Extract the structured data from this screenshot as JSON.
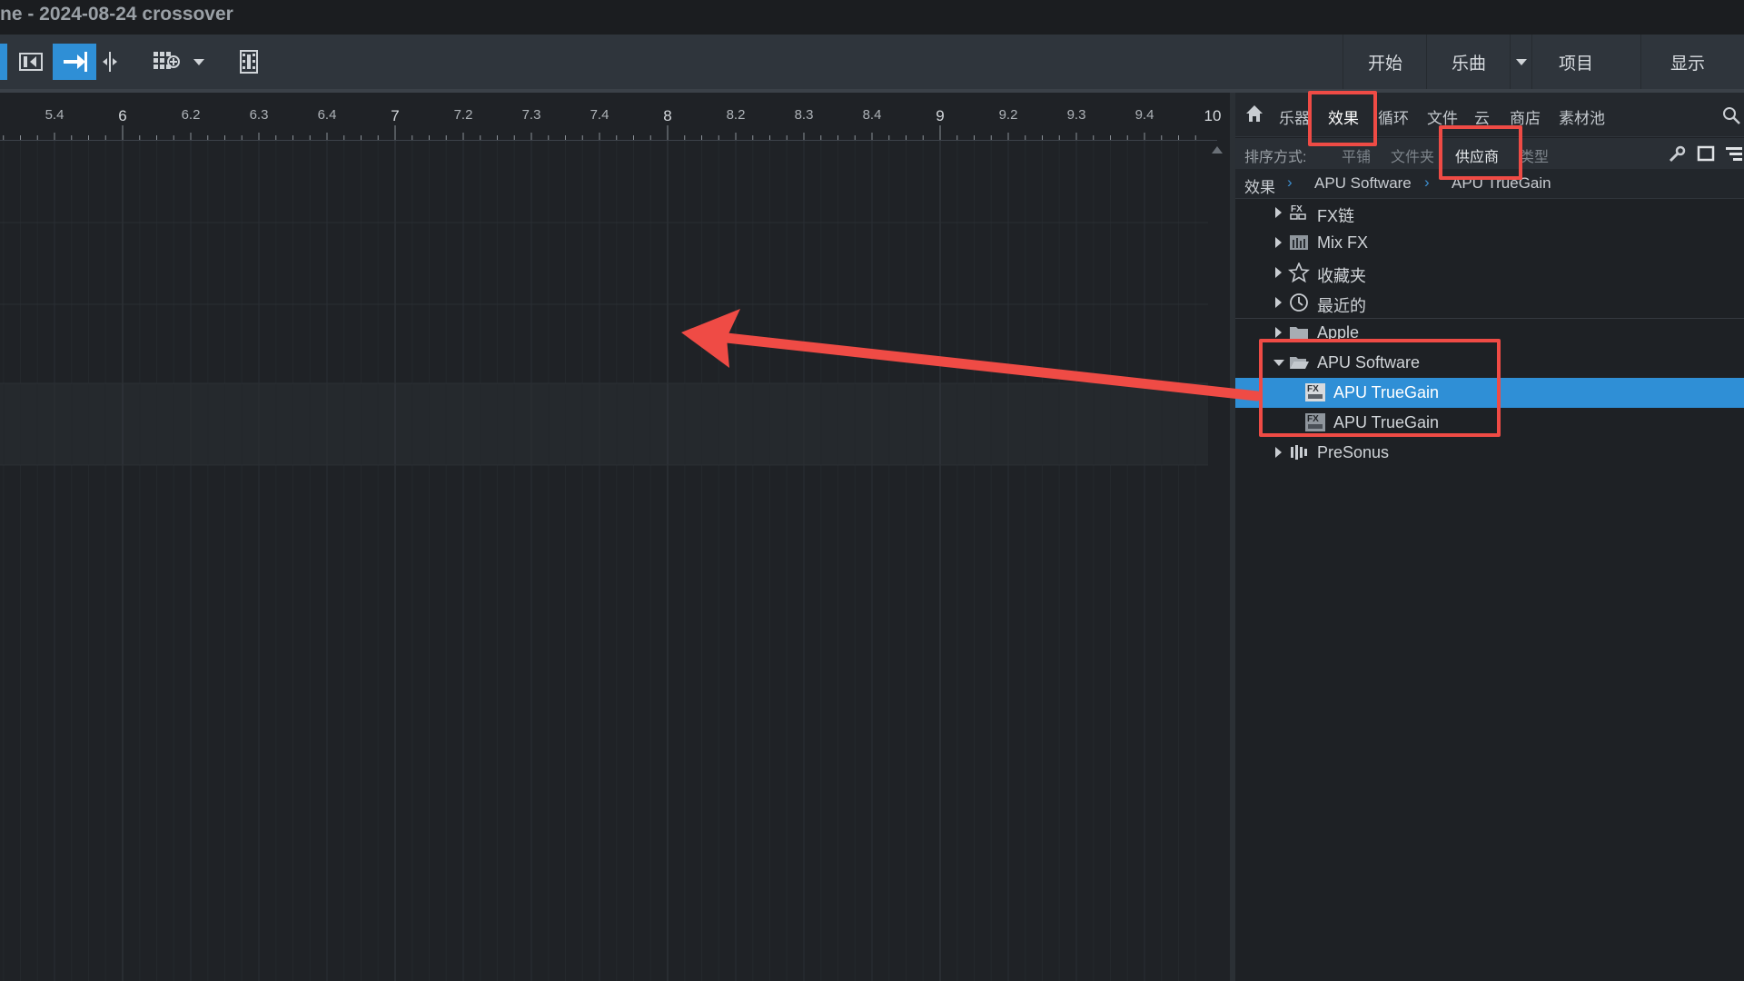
{
  "window": {
    "title": "ne - 2024-08-24 crossover"
  },
  "toolbar": {
    "nav": [
      "开始",
      "乐曲",
      "项目",
      "显示"
    ]
  },
  "ruler": {
    "ticks": [
      "5.4",
      "6",
      "6.2",
      "6.3",
      "6.4",
      "7",
      "7.2",
      "7.3",
      "7.4",
      "8",
      "8.2",
      "8.3",
      "8.4",
      "9",
      "9.2",
      "9.3",
      "9.4",
      "10"
    ],
    "major": [
      "6",
      "7",
      "8",
      "9",
      "10"
    ]
  },
  "browser": {
    "tabs": [
      "乐器",
      "效果",
      "循环",
      "文件",
      "云",
      "商店",
      "素材池"
    ],
    "active_tab": "效果",
    "sort": {
      "label": "排序方式:",
      "options": [
        "平铺",
        "文件夹",
        "供应商",
        "类型"
      ],
      "active": "供应商"
    },
    "breadcrumb": [
      "效果",
      "APU Software",
      "APU TrueGain"
    ],
    "tree": [
      {
        "label": "FX链",
        "icon": "fx-chain-icon",
        "expanded": false,
        "indent": 0
      },
      {
        "label": "Mix FX",
        "icon": "mix-fx-icon",
        "expanded": false,
        "indent": 0
      },
      {
        "label": "收藏夹",
        "icon": "star-icon",
        "expanded": false,
        "indent": 0
      },
      {
        "label": "最近的",
        "icon": "clock-icon",
        "expanded": false,
        "indent": 0
      },
      {
        "label": "Apple",
        "icon": "folder-icon",
        "expanded": false,
        "indent": 0
      },
      {
        "label": "APU Software",
        "icon": "folder-open-icon",
        "expanded": true,
        "indent": 0
      },
      {
        "label": "APU TrueGain",
        "icon": "fx-plugin-icon",
        "indent": 1,
        "selected": true
      },
      {
        "label": "APU TrueGain",
        "icon": "fx-plugin-au-icon",
        "indent": 1
      },
      {
        "label": "PreSonus",
        "icon": "presonus-icon",
        "expanded": false,
        "indent": 0
      }
    ]
  },
  "colors": {
    "accent": "#2f8fd6",
    "annotation": "#ef4b45"
  }
}
